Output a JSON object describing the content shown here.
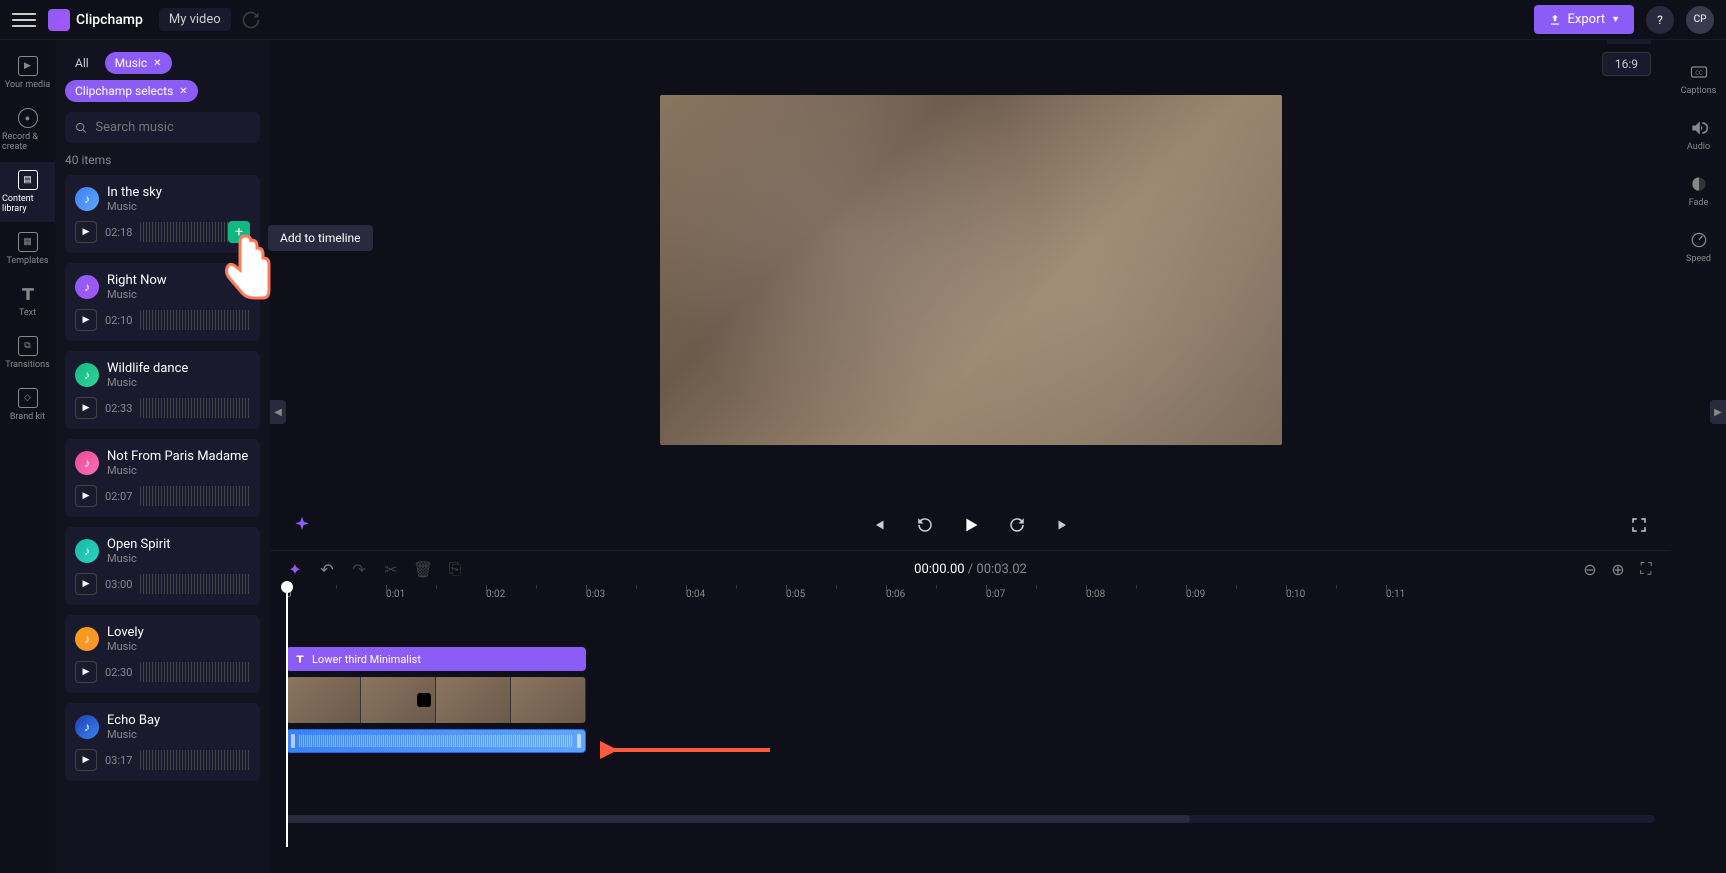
{
  "header": {
    "brand": "Clipchamp",
    "project_name": "My video",
    "export_label": "Export",
    "avatar_initials": "CP"
  },
  "left_nav": [
    {
      "label": "Your media",
      "icon": "media"
    },
    {
      "label": "Record & create",
      "icon": "record"
    },
    {
      "label": "Content library",
      "icon": "library"
    },
    {
      "label": "Templates",
      "icon": "templates"
    },
    {
      "label": "Text",
      "icon": "text"
    },
    {
      "label": "Transitions",
      "icon": "transitions"
    },
    {
      "label": "Brand kit",
      "icon": "brand"
    }
  ],
  "media_panel": {
    "chip_all": "All",
    "chip_music": "Music",
    "chip_selects": "Clipchamp selects",
    "search_placeholder": "Search music",
    "item_count": "40 items",
    "tooltip": "Add to timeline",
    "tracks": [
      {
        "title": "In the sky",
        "sub": "Music",
        "duration": "02:18",
        "color": "blue"
      },
      {
        "title": "Right Now",
        "sub": "Music",
        "duration": "02:10",
        "color": "purple"
      },
      {
        "title": "Wildlife dance",
        "sub": "Music",
        "duration": "02:33",
        "color": "green"
      },
      {
        "title": "Not From Paris Madame",
        "sub": "Music",
        "duration": "02:07",
        "color": "pink"
      },
      {
        "title": "Open Spirit",
        "sub": "Music",
        "duration": "03:00",
        "color": "teal"
      },
      {
        "title": "Lovely",
        "sub": "Music",
        "duration": "02:30",
        "color": "orange"
      },
      {
        "title": "Echo Bay",
        "sub": "Music",
        "duration": "03:17",
        "color": "darkblue"
      }
    ]
  },
  "preview": {
    "aspect_ratio": "16:9"
  },
  "right_panel": [
    {
      "label": "Captions"
    },
    {
      "label": "Audio"
    },
    {
      "label": "Fade"
    },
    {
      "label": "Speed"
    }
  ],
  "timeline": {
    "current_time": "00:00.00",
    "separator": " / ",
    "total_time": "00:03.02",
    "text_clip_label": "Lower third Minimalist",
    "ruler_ticks": [
      "0",
      "0:01",
      "0:02",
      "0:03",
      "0:04",
      "0:05",
      "0:06",
      "0:07",
      "0:08",
      "0:09",
      "0:10",
      "0:11"
    ]
  }
}
